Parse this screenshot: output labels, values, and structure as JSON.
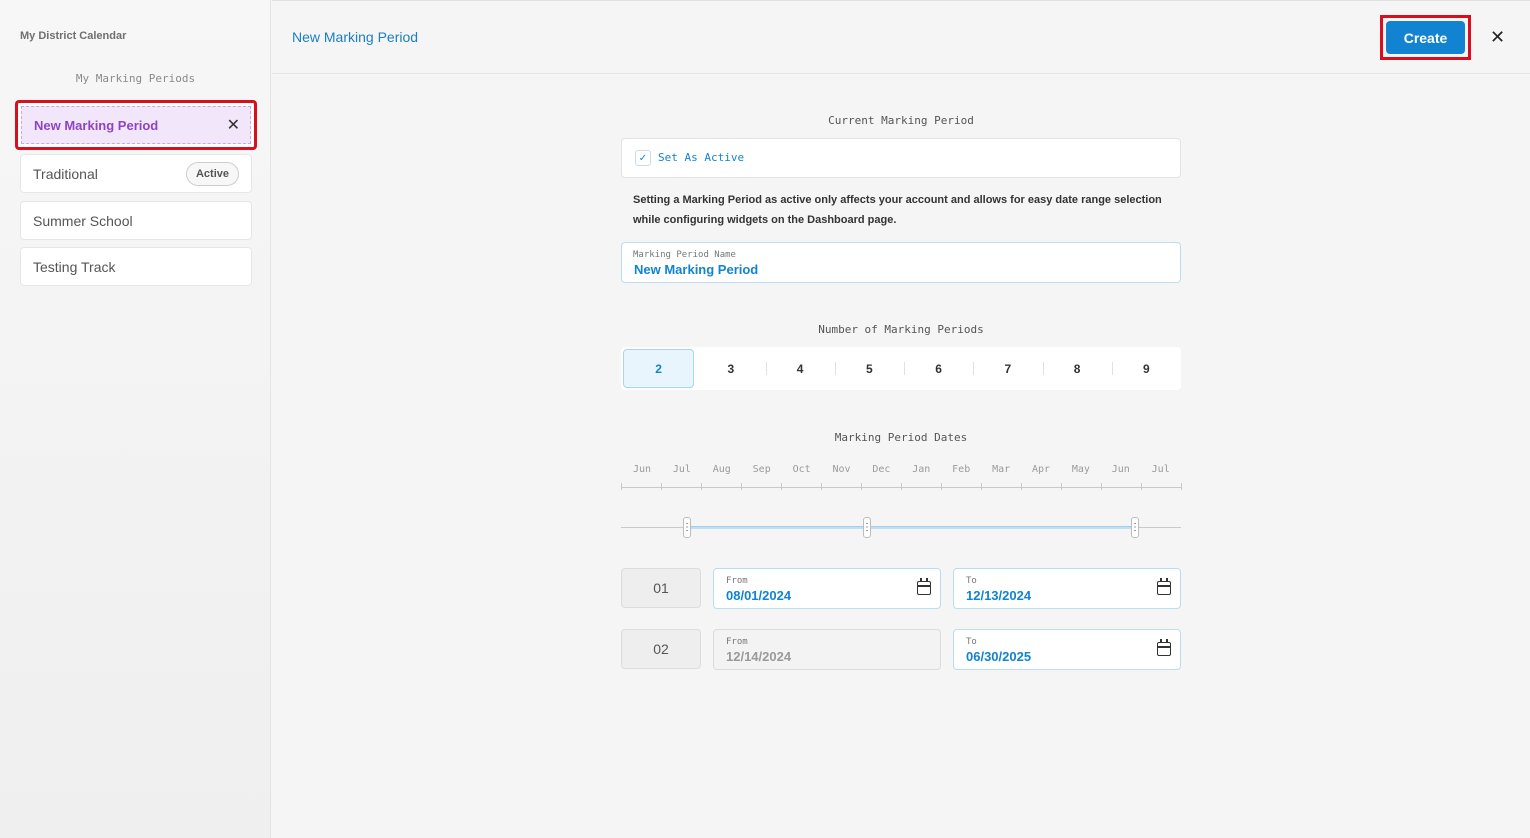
{
  "sidebar": {
    "title": "My District Calendar",
    "subtitle": "My Marking Periods",
    "items": [
      {
        "label": "New Marking Period",
        "selected": true
      },
      {
        "label": "Traditional",
        "badge": "Active"
      },
      {
        "label": "Summer School"
      },
      {
        "label": "Testing Track"
      }
    ]
  },
  "header": {
    "title": "New Marking Period",
    "create_label": "Create",
    "close_icon": "close-icon"
  },
  "form": {
    "current_label": "Current Marking Period",
    "set_active_label": "Set As Active",
    "set_active_checked": true,
    "note": "Setting a Marking Period as active only affects your account and allows for easy date range selection while configuring widgets on the Dashboard page.",
    "name_label": "Marking Period Name",
    "name_value": "New Marking Period",
    "number_label": "Number of Marking Periods",
    "numbers": [
      "2",
      "3",
      "4",
      "5",
      "6",
      "7",
      "8",
      "9"
    ],
    "selected_number": "2",
    "dates_label": "Marking Period Dates",
    "months": [
      "Jun",
      "Jul",
      "Aug",
      "Sep",
      "Oct",
      "Nov",
      "Dec",
      "Jan",
      "Feb",
      "Mar",
      "Apr",
      "May",
      "Jun",
      "Jul"
    ],
    "periods": [
      {
        "num": "01",
        "from_label": "From",
        "from": "08/01/2024",
        "to_label": "To",
        "to": "12/13/2024"
      },
      {
        "num": "02",
        "from_label": "From",
        "from": "12/14/2024",
        "to_label": "To",
        "to": "06/30/2025"
      }
    ]
  },
  "colors": {
    "accent": "#1183d1",
    "highlight": "#d80f1c",
    "selected_item": "#8e44c4"
  }
}
